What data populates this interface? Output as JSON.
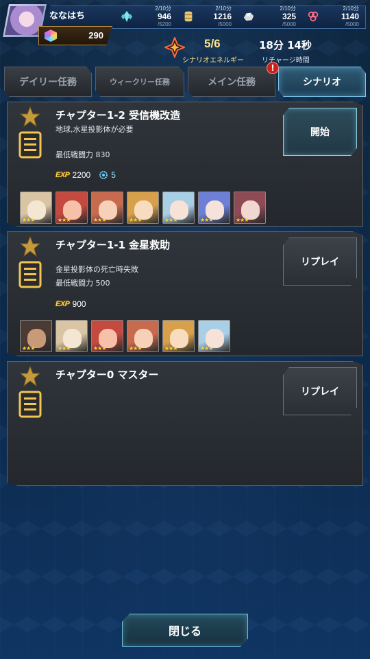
{
  "player": {
    "name": "ななはち",
    "gems": "290"
  },
  "resources": [
    {
      "icon": "crystal-icon",
      "cap": "2/10分",
      "value": "946",
      "max": "/5200"
    },
    {
      "icon": "scroll-icon",
      "cap": "2/10分",
      "value": "1216",
      "max": "/5000"
    },
    {
      "icon": "ore-icon",
      "cap": "2/10分",
      "value": "325",
      "max": "/5000"
    },
    {
      "icon": "core-icon",
      "cap": "2/10分",
      "value": "1140",
      "max": "/5000"
    }
  ],
  "energy": {
    "value": "5/6",
    "label": "シナリオエネルギー",
    "recharge_value": "18分 14秒",
    "recharge_label": "リチャージ時間"
  },
  "tabs": [
    {
      "label": "デイリー任務"
    },
    {
      "label": "ウィークリー任務"
    },
    {
      "label": "メイン任務"
    },
    {
      "label": "シナリオ",
      "active": true
    }
  ],
  "alert_badge": "!",
  "missions": [
    {
      "title": "チャプター1-2 受信機改造",
      "desc": "地球,水星投影体が必要",
      "power": "最低戦闘力 830",
      "exp_badge": "EXP",
      "exp": "2200",
      "gear": "5",
      "button": "開始",
      "characters": 7
    },
    {
      "title": "チャプター1-1 金星救助",
      "desc": "金星投影体の死亡時失敗",
      "power": "最低戦闘力 500",
      "exp_badge": "EXP",
      "exp": "900",
      "button": "リプレイ",
      "characters": 6
    },
    {
      "title": "チャプター0 マスター",
      "button": "リプレイ"
    }
  ],
  "character_stars": "★★★",
  "close_button": "閉じる",
  "colors": {
    "accent": "#7fc4e6",
    "gold": "#ffd14a",
    "alert": "#c8221f"
  }
}
